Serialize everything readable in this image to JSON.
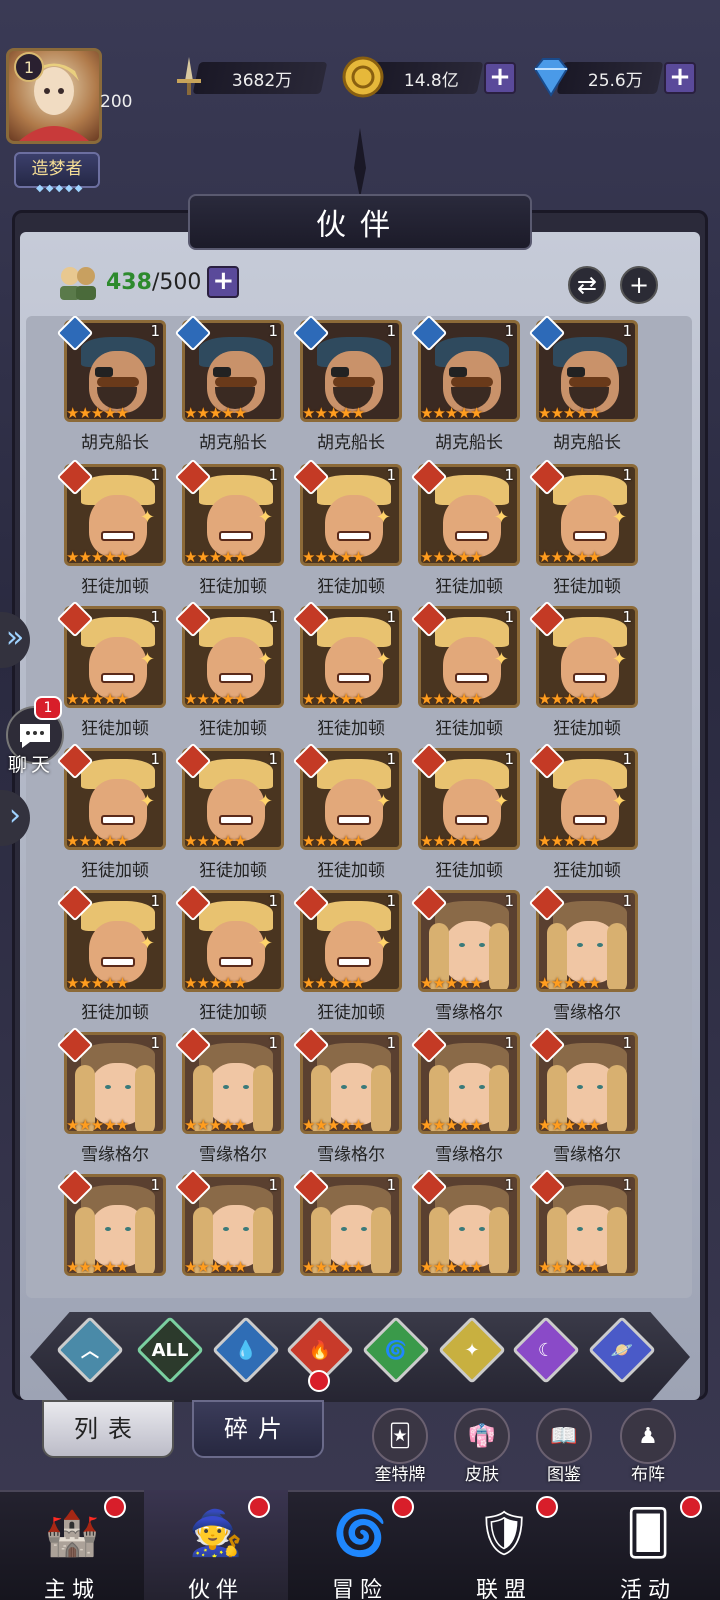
{
  "player": {
    "level": "1",
    "level_value": "200",
    "title": "造梦者",
    "title_stars": "◆◆◆◆◆"
  },
  "resources": {
    "power": "3682万",
    "gold": "14.8亿",
    "diamonds": "25.6万"
  },
  "header": {
    "title": "伙伴"
  },
  "roster": {
    "current": "438",
    "max": "/500"
  },
  "cards": [
    {
      "name": "胡克船长",
      "count": "1",
      "element": "water",
      "hero": "captain"
    },
    {
      "name": "胡克船长",
      "count": "1",
      "element": "water",
      "hero": "captain"
    },
    {
      "name": "胡克船长",
      "count": "1",
      "element": "water",
      "hero": "captain"
    },
    {
      "name": "胡克船长",
      "count": "1",
      "element": "water",
      "hero": "captain"
    },
    {
      "name": "胡克船长",
      "count": "1",
      "element": "water",
      "hero": "captain"
    },
    {
      "name": "狂徒加顿",
      "count": "1",
      "element": "fire",
      "hero": "gaston"
    },
    {
      "name": "狂徒加顿",
      "count": "1",
      "element": "fire",
      "hero": "gaston"
    },
    {
      "name": "狂徒加顿",
      "count": "1",
      "element": "fire",
      "hero": "gaston"
    },
    {
      "name": "狂徒加顿",
      "count": "1",
      "element": "fire",
      "hero": "gaston"
    },
    {
      "name": "狂徒加顿",
      "count": "1",
      "element": "fire",
      "hero": "gaston"
    },
    {
      "name": "狂徒加顿",
      "count": "1",
      "element": "fire",
      "hero": "gaston"
    },
    {
      "name": "狂徒加顿",
      "count": "1",
      "element": "fire",
      "hero": "gaston"
    },
    {
      "name": "狂徒加顿",
      "count": "1",
      "element": "fire",
      "hero": "gaston"
    },
    {
      "name": "狂徒加顿",
      "count": "1",
      "element": "fire",
      "hero": "gaston"
    },
    {
      "name": "狂徒加顿",
      "count": "1",
      "element": "fire",
      "hero": "gaston"
    },
    {
      "name": "狂徒加顿",
      "count": "1",
      "element": "fire",
      "hero": "gaston"
    },
    {
      "name": "狂徒加顿",
      "count": "1",
      "element": "fire",
      "hero": "gaston"
    },
    {
      "name": "狂徒加顿",
      "count": "1",
      "element": "fire",
      "hero": "gaston"
    },
    {
      "name": "狂徒加顿",
      "count": "1",
      "element": "fire",
      "hero": "gaston"
    },
    {
      "name": "狂徒加顿",
      "count": "1",
      "element": "fire",
      "hero": "gaston"
    },
    {
      "name": "狂徒加顿",
      "count": "1",
      "element": "fire",
      "hero": "gaston"
    },
    {
      "name": "狂徒加顿",
      "count": "1",
      "element": "fire",
      "hero": "gaston"
    },
    {
      "name": "狂徒加顿",
      "count": "1",
      "element": "fire",
      "hero": "gaston"
    },
    {
      "name": "雪缘格尔",
      "count": "1",
      "element": "fire",
      "hero": "gretel"
    },
    {
      "name": "雪缘格尔",
      "count": "1",
      "element": "fire",
      "hero": "gretel"
    },
    {
      "name": "雪缘格尔",
      "count": "1",
      "element": "fire",
      "hero": "gretel"
    },
    {
      "name": "雪缘格尔",
      "count": "1",
      "element": "fire",
      "hero": "gretel"
    },
    {
      "name": "雪缘格尔",
      "count": "1",
      "element": "fire",
      "hero": "gretel"
    },
    {
      "name": "雪缘格尔",
      "count": "1",
      "element": "fire",
      "hero": "gretel"
    },
    {
      "name": "雪缘格尔",
      "count": "1",
      "element": "fire",
      "hero": "gretel"
    },
    {
      "name": "",
      "count": "1",
      "element": "fire",
      "hero": "gretel"
    },
    {
      "name": "",
      "count": "1",
      "element": "fire",
      "hero": "gretel"
    },
    {
      "name": "",
      "count": "1",
      "element": "fire",
      "hero": "gretel"
    },
    {
      "name": "",
      "count": "1",
      "element": "fire",
      "hero": "gretel"
    },
    {
      "name": "",
      "count": "1",
      "element": "fire",
      "hero": "gretel"
    }
  ],
  "stars": "★★★★★",
  "filters": [
    {
      "key": "up",
      "color": "#4a8aa8",
      "label": "︿"
    },
    {
      "key": "all",
      "color": "#2c3a2c",
      "label": "ALL"
    },
    {
      "key": "water",
      "color": "#2f6db5",
      "label": "💧"
    },
    {
      "key": "fire",
      "color": "#c83a2a",
      "label": "🔥"
    },
    {
      "key": "wind",
      "color": "#3a9a4a",
      "label": "🌀"
    },
    {
      "key": "light",
      "color": "#c8b040",
      "label": "✦"
    },
    {
      "key": "dark",
      "color": "#8a4ac8",
      "label": "☾"
    },
    {
      "key": "cosmic",
      "color": "#4a5ac8",
      "label": "🪐"
    }
  ],
  "tabs": {
    "list": "列表",
    "fragments": "碎片"
  },
  "tools": [
    {
      "label": "奎特牌",
      "icon": "🃏"
    },
    {
      "label": "皮肤",
      "icon": "👘"
    },
    {
      "label": "图鉴",
      "icon": "📖"
    },
    {
      "label": "布阵",
      "icon": "♟"
    }
  ],
  "nav": [
    {
      "label": "主城",
      "icon": "🏰",
      "dot": true
    },
    {
      "label": "伙伴",
      "icon": "🧙",
      "dot": true,
      "active": true
    },
    {
      "label": "冒险",
      "icon": "🌀",
      "dot": true
    },
    {
      "label": "联盟",
      "icon": "🛡",
      "dot": true
    },
    {
      "label": "活动",
      "icon": "🂠",
      "dot": true
    }
  ],
  "chat": {
    "label": "聊天",
    "badge": "1"
  },
  "colors": {
    "water": "#2d6ab8",
    "fire": "#c43a25",
    "accent": "#5a4a9a",
    "green": "#2d8a2d"
  }
}
